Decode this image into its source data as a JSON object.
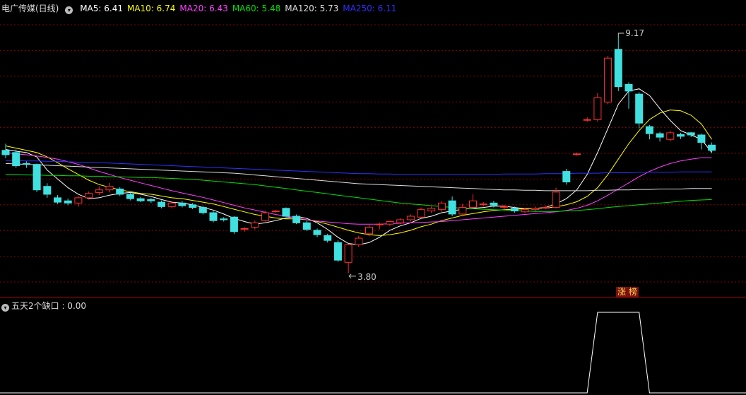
{
  "header": {
    "stock_name": "电广传媒(日线)",
    "ma_items": [
      {
        "label": "MA5: 6.41",
        "color": "#ffffff"
      },
      {
        "label": "MA10: 6.74",
        "color": "#ffff00"
      },
      {
        "label": "MA20: 6.43",
        "color": "#ff40ff"
      },
      {
        "label": "MA60: 5.48",
        "color": "#00e000"
      },
      {
        "label": "MA120: 5.73",
        "color": "#dddddd"
      },
      {
        "label": "MA250: 6.11",
        "color": "#3030ff"
      }
    ]
  },
  "indicator": {
    "label": "五天2个缺口 : 0.00"
  },
  "badge": {
    "text": "涨 榜"
  },
  "colors": {
    "up": "#ff3030",
    "down": "#40e0e0",
    "grid": "#8b0000",
    "separator": "#aa0000"
  },
  "chart_data": {
    "type": "candlestick",
    "high_label": "9.17",
    "low_label": "3.80",
    "price_range": [
      3.62,
      9.54
    ],
    "candles": [
      [
        6.6,
        6.5,
        6.75,
        6.42
      ],
      [
        6.55,
        6.25,
        6.62,
        6.2
      ],
      [
        6.3,
        6.28,
        6.35,
        6.2
      ],
      [
        6.28,
        5.7,
        6.3,
        5.65
      ],
      [
        5.78,
        5.6,
        5.85,
        5.52
      ],
      [
        5.52,
        5.42,
        5.58,
        5.38
      ],
      [
        5.45,
        5.4,
        5.5,
        5.35
      ],
      [
        5.4,
        5.52,
        5.56,
        5.32
      ],
      [
        5.52,
        5.62,
        5.66,
        5.48
      ],
      [
        5.64,
        5.7,
        5.78,
        5.58
      ],
      [
        5.7,
        5.78,
        5.86,
        5.64
      ],
      [
        5.72,
        5.6,
        5.76,
        5.56
      ],
      [
        5.6,
        5.5,
        5.64,
        5.46
      ],
      [
        5.5,
        5.45,
        5.54,
        5.42
      ],
      [
        5.48,
        5.45,
        5.52,
        5.4
      ],
      [
        5.42,
        5.32,
        5.46,
        5.28
      ],
      [
        5.32,
        5.4,
        5.44,
        5.28
      ],
      [
        5.4,
        5.34,
        5.45,
        5.3
      ],
      [
        5.36,
        5.3,
        5.4,
        5.26
      ],
      [
        5.3,
        5.18,
        5.34,
        5.14
      ],
      [
        5.18,
        5.0,
        5.22,
        4.96
      ],
      [
        5.04,
        5.02,
        5.08,
        4.98
      ],
      [
        5.08,
        4.75,
        5.1,
        4.7
      ],
      [
        4.82,
        4.82,
        4.85,
        4.75
      ],
      [
        4.85,
        4.95,
        5.0,
        4.8
      ],
      [
        5.0,
        5.18,
        5.22,
        4.98
      ],
      [
        5.22,
        5.22,
        5.24,
        5.18
      ],
      [
        5.28,
        5.1,
        5.3,
        5.08
      ],
      [
        5.1,
        4.95,
        5.14,
        4.92
      ],
      [
        4.95,
        4.8,
        5.0,
        4.76
      ],
      [
        4.78,
        4.68,
        4.82,
        4.62
      ],
      [
        4.66,
        4.55,
        4.7,
        4.5
      ],
      [
        4.5,
        4.1,
        4.55,
        4.06
      ],
      [
        4.05,
        4.45,
        4.48,
        3.8
      ],
      [
        4.45,
        4.6,
        4.65,
        4.4
      ],
      [
        4.7,
        4.85,
        4.9,
        4.65
      ],
      [
        4.92,
        4.92,
        4.95,
        4.8
      ],
      [
        4.92,
        4.98,
        5.0,
        4.88
      ],
      [
        4.95,
        5.02,
        5.05,
        4.92
      ],
      [
        5.02,
        5.1,
        5.14,
        4.98
      ],
      [
        5.08,
        5.25,
        5.3,
        5.05
      ],
      [
        5.22,
        5.28,
        5.32,
        5.18
      ],
      [
        5.25,
        5.4,
        5.45,
        5.2
      ],
      [
        5.45,
        5.15,
        5.55,
        5.1
      ],
      [
        5.15,
        5.3,
        5.38,
        5.12
      ],
      [
        5.3,
        5.45,
        5.6,
        5.28
      ],
      [
        5.38,
        5.38,
        5.42,
        5.32
      ],
      [
        5.4,
        5.35,
        5.45,
        5.3
      ],
      [
        5.32,
        5.32,
        5.36,
        5.26
      ],
      [
        5.28,
        5.22,
        5.32,
        5.18
      ],
      [
        5.2,
        5.25,
        5.28,
        5.18
      ],
      [
        5.25,
        5.28,
        5.32,
        5.22
      ],
      [
        5.28,
        5.3,
        5.34,
        5.26
      ],
      [
        5.3,
        5.65,
        5.75,
        5.28
      ],
      [
        6.12,
        5.88,
        6.18,
        5.82
      ],
      [
        6.52,
        6.52,
        6.55,
        6.48
      ],
      [
        7.3,
        7.3,
        7.35,
        7.25
      ],
      [
        7.3,
        7.8,
        7.9,
        7.25
      ],
      [
        7.7,
        8.7,
        8.75,
        7.65
      ],
      [
        8.9,
        8.05,
        9.17,
        7.95
      ],
      [
        8.1,
        7.95,
        8.15,
        7.55
      ],
      [
        7.88,
        7.22,
        7.92,
        7.1
      ],
      [
        7.14,
        6.98,
        7.18,
        6.85
      ],
      [
        6.98,
        6.9,
        7.02,
        6.8
      ],
      [
        6.85,
        7.0,
        7.05,
        6.8
      ],
      [
        6.96,
        6.92,
        7.0,
        6.86
      ],
      [
        7.0,
        6.95,
        7.02,
        6.9
      ],
      [
        6.95,
        6.78,
        6.98,
        6.62
      ],
      [
        6.72,
        6.6,
        6.78,
        6.54
      ]
    ],
    "ma5": [
      6.62,
      6.58,
      6.55,
      6.45,
      6.15,
      5.95,
      5.75,
      5.6,
      5.5,
      5.52,
      5.58,
      5.62,
      5.64,
      5.6,
      5.55,
      5.48,
      5.42,
      5.4,
      5.36,
      5.3,
      5.24,
      5.15,
      5.05,
      4.98,
      4.92,
      4.95,
      5.0,
      5.06,
      5.1,
      5.05,
      4.95,
      4.8,
      4.62,
      4.48,
      4.45,
      4.5,
      4.62,
      4.78,
      4.88,
      4.95,
      5.05,
      5.1,
      5.18,
      5.22,
      5.26,
      5.28,
      5.3,
      5.33,
      5.33,
      5.3,
      5.27,
      5.28,
      5.3,
      5.38,
      5.5,
      5.7,
      6.05,
      6.55,
      7.1,
      7.65,
      7.95,
      8.0,
      7.85,
      7.55,
      7.28,
      7.05,
      6.95,
      6.85,
      6.55
    ],
    "ma10": [
      6.7,
      6.65,
      6.6,
      6.55,
      6.45,
      6.32,
      6.18,
      6.05,
      5.92,
      5.82,
      5.76,
      5.7,
      5.66,
      5.62,
      5.6,
      5.56,
      5.52,
      5.5,
      5.46,
      5.42,
      5.38,
      5.32,
      5.26,
      5.2,
      5.14,
      5.1,
      5.06,
      5.04,
      5.04,
      5.02,
      4.98,
      4.92,
      4.85,
      4.78,
      4.72,
      4.68,
      4.66,
      4.68,
      4.72,
      4.78,
      4.86,
      4.92,
      5.0,
      5.06,
      5.12,
      5.16,
      5.2,
      5.23,
      5.25,
      5.26,
      5.27,
      5.28,
      5.29,
      5.31,
      5.36,
      5.43,
      5.55,
      5.75,
      6.05,
      6.4,
      6.75,
      7.05,
      7.3,
      7.45,
      7.52,
      7.5,
      7.4,
      7.2,
      6.85
    ],
    "ma20": [
      6.55,
      6.52,
      6.5,
      6.47,
      6.44,
      6.4,
      6.34,
      6.28,
      6.2,
      6.12,
      6.05,
      5.98,
      5.92,
      5.86,
      5.8,
      5.74,
      5.68,
      5.63,
      5.58,
      5.53,
      5.47,
      5.41,
      5.35,
      5.29,
      5.24,
      5.19,
      5.14,
      5.1,
      5.06,
      5.02,
      4.99,
      4.97,
      4.95,
      4.93,
      4.92,
      4.92,
      4.92,
      4.93,
      4.94,
      4.95,
      4.96,
      4.97,
      4.98,
      5.0,
      5.02,
      5.04,
      5.06,
      5.08,
      5.1,
      5.12,
      5.14,
      5.16,
      5.18,
      5.2,
      5.23,
      5.28,
      5.35,
      5.45,
      5.58,
      5.72,
      5.86,
      6.0,
      6.12,
      6.22,
      6.3,
      6.36,
      6.4,
      6.43,
      6.43
    ],
    "ma60": [
      6.05,
      6.05,
      6.04,
      6.04,
      6.03,
      6.03,
      6.02,
      6.02,
      6.01,
      6.01,
      6.0,
      6.0,
      5.99,
      5.98,
      5.98,
      5.97,
      5.96,
      5.95,
      5.94,
      5.92,
      5.9,
      5.88,
      5.86,
      5.84,
      5.82,
      5.79,
      5.76,
      5.73,
      5.7,
      5.67,
      5.64,
      5.61,
      5.58,
      5.55,
      5.52,
      5.49,
      5.46,
      5.43,
      5.4,
      5.38,
      5.36,
      5.34,
      5.32,
      5.3,
      5.28,
      5.27,
      5.26,
      5.25,
      5.24,
      5.23,
      5.22,
      5.21,
      5.21,
      5.21,
      5.22,
      5.23,
      5.25,
      5.27,
      5.3,
      5.32,
      5.34,
      5.36,
      5.38,
      5.4,
      5.42,
      5.44,
      5.46,
      5.47,
      5.48
    ],
    "ma120": [
      6.3,
      6.29,
      6.28,
      6.27,
      6.26,
      6.25,
      6.24,
      6.23,
      6.22,
      6.21,
      6.2,
      6.19,
      6.18,
      6.17,
      6.16,
      6.15,
      6.14,
      6.13,
      6.12,
      6.11,
      6.1,
      6.09,
      6.08,
      6.06,
      6.04,
      6.02,
      6.0,
      5.98,
      5.96,
      5.94,
      5.92,
      5.9,
      5.88,
      5.86,
      5.84,
      5.83,
      5.82,
      5.81,
      5.8,
      5.79,
      5.78,
      5.77,
      5.76,
      5.75,
      5.74,
      5.73,
      5.72,
      5.71,
      5.7,
      5.7,
      5.69,
      5.69,
      5.68,
      5.68,
      5.68,
      5.68,
      5.68,
      5.69,
      5.69,
      5.7,
      5.7,
      5.71,
      5.71,
      5.72,
      5.72,
      5.72,
      5.73,
      5.73,
      5.73
    ],
    "ma250": [
      6.37,
      6.37,
      6.36,
      6.36,
      6.35,
      6.35,
      6.34,
      6.33,
      6.33,
      6.32,
      6.31,
      6.3,
      6.29,
      6.28,
      6.27,
      6.26,
      6.25,
      6.24,
      6.23,
      6.22,
      6.21,
      6.2,
      6.19,
      6.18,
      6.17,
      6.16,
      6.15,
      6.14,
      6.13,
      6.12,
      6.11,
      6.1,
      6.09,
      6.08,
      6.07,
      6.07,
      6.06,
      6.06,
      6.05,
      6.05,
      6.05,
      6.05,
      6.05,
      6.05,
      6.05,
      6.05,
      6.05,
      6.05,
      6.06,
      6.06,
      6.06,
      6.06,
      6.07,
      6.07,
      6.07,
      6.08,
      6.08,
      6.08,
      6.09,
      6.09,
      6.09,
      6.1,
      6.1,
      6.1,
      6.1,
      6.11,
      6.11,
      6.11,
      6.11
    ],
    "indicator": [
      0,
      0,
      0,
      0,
      0,
      0,
      0,
      0,
      0,
      0,
      0,
      0,
      0,
      0,
      0,
      0,
      0,
      0,
      0,
      0,
      0,
      0,
      0,
      0,
      0,
      0,
      0,
      0,
      0,
      0,
      0,
      0,
      0,
      0,
      0,
      0,
      0,
      0,
      0,
      0,
      0,
      0,
      0,
      0,
      0,
      0,
      0,
      0,
      0,
      0,
      0,
      0,
      0,
      0,
      0,
      0,
      0,
      1,
      1,
      1,
      1,
      1,
      0,
      0,
      0,
      0,
      0,
      0,
      0
    ],
    "indicator_range": [
      0,
      1
    ]
  }
}
